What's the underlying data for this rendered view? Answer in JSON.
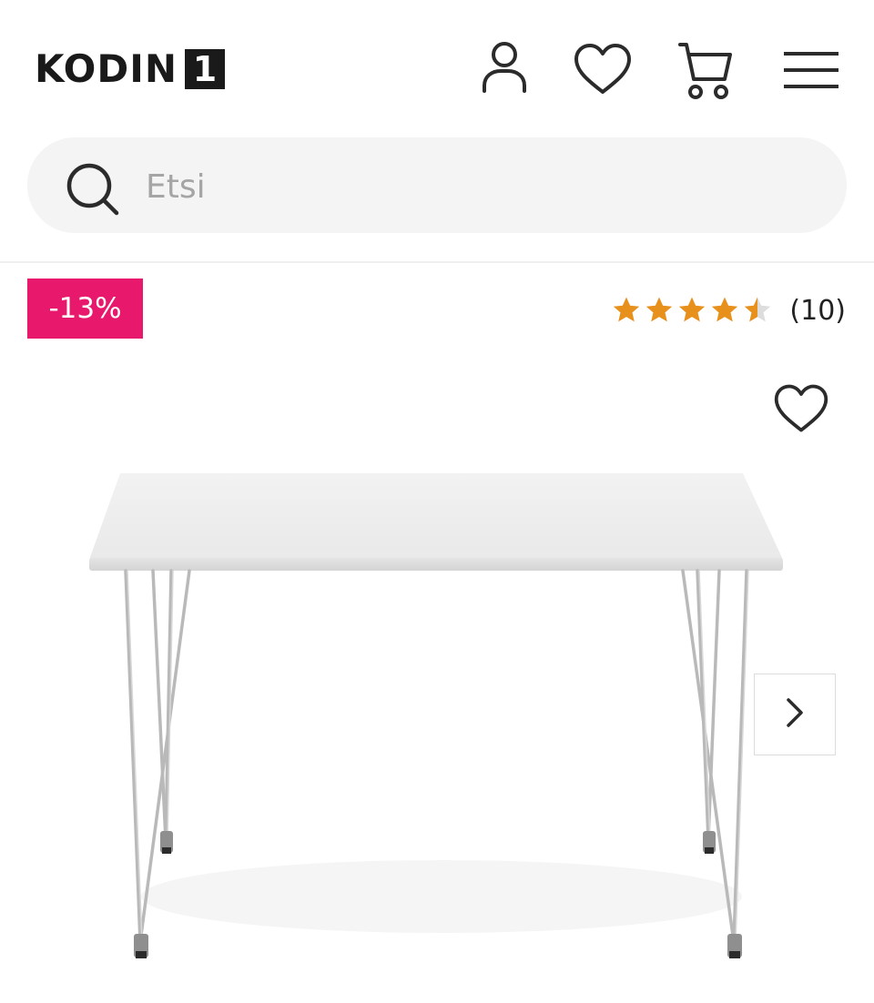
{
  "header": {
    "logo": {
      "text": "KODIN",
      "box": "1"
    },
    "icons": [
      "user-icon",
      "heart-icon",
      "cart-icon",
      "menu-icon"
    ]
  },
  "search": {
    "placeholder": "Etsi",
    "value": ""
  },
  "product": {
    "discount_badge": "-13%",
    "rating": {
      "stars": 4.5,
      "max": 5,
      "count_label": "(10)"
    },
    "image": "white rectangular table with chrome hairpin legs"
  },
  "colors": {
    "badge_bg": "#e8196d",
    "star_fill": "#e8901c",
    "star_empty": "#dddddd",
    "search_bg": "#f4f4f4"
  }
}
